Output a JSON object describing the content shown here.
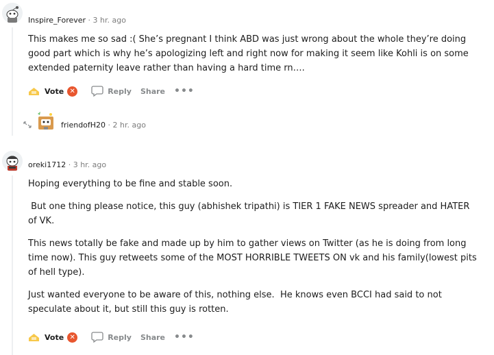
{
  "comments": [
    {
      "username": "Inspire_Forever",
      "sep": "·",
      "time": "3 hr. ago",
      "body": [
        "This makes me so sad :( She’s pregnant I think ABD was just wrong about the whole they’re doing good part which is why he’s apologizing left and right now for making it seem like Kohli is on some extended paternity leave rather than having a hard time rn…."
      ],
      "actions": {
        "vote": "Vote",
        "reply": "Reply",
        "share": "Share"
      }
    },
    {
      "username": "friendofH20",
      "sep": "·",
      "time": "2 hr. ago",
      "collapsed": true
    },
    {
      "username": "oreki1712",
      "sep": "·",
      "time": "3 hr. ago",
      "body": [
        "Hoping everything to be fine and stable soon.",
        " But one thing please notice, this guy (abhishek tripathi) is TIER 1 FAKE NEWS spreader and HATER of VK.",
        "This news totally be fake and made up by him to gather views on Twitter (as he is doing from long time now). This guy retweets some of the MOST HORRIBLE TWEETS ON vk and his family(lowest pits of hell type).",
        "Just wanted everyone to be aware of this, nothing else.  He knows even BCCI had said to not speculate about it, but still this guy is rotten."
      ],
      "actions": {
        "vote": "Vote",
        "reply": "Reply",
        "share": "Share"
      }
    }
  ],
  "icons": {
    "award": "award-icon",
    "remove": "x-icon",
    "reply": "speech-bubble-icon",
    "more": "more-dots-icon",
    "expand": "expand-arrows-icon"
  },
  "colors": {
    "meta_gray": "#7c7c7c",
    "action_gray": "#878a8c",
    "thread_line": "#edeff1",
    "badge_orange": "#e8562e"
  }
}
